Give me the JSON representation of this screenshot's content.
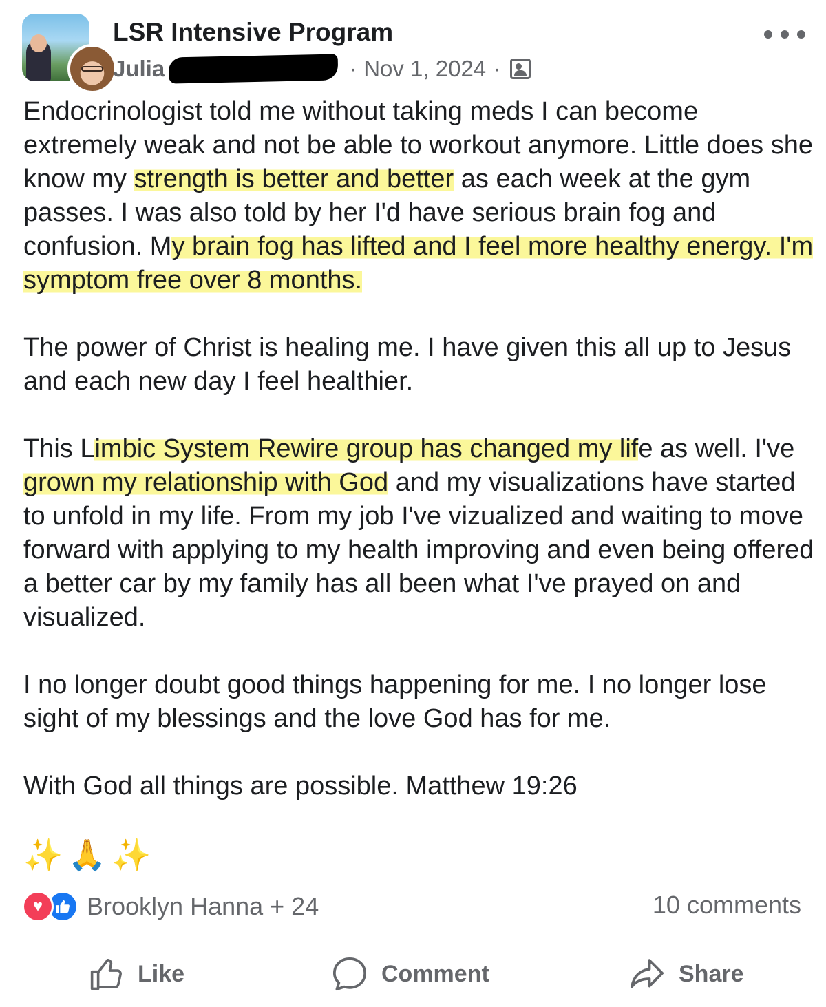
{
  "header": {
    "group_name": "LSR Intensive Program",
    "author_name": "Julia",
    "separator": "·",
    "date": "Nov 1, 2024",
    "privacy_icon": "members-group-icon",
    "more_icon": "more-options-icon"
  },
  "body": {
    "paragraphs": [
      [
        {
          "t": "Endocrinologist told me without taking meds I can become extremely weak and not be able to workout anymore. Little does she know my ",
          "hl": false
        },
        {
          "t": "strength is better and better",
          "hl": true
        },
        {
          "t": " as each week at the gym passes. I was also told by her I'd have serious brain fog and confusion. M",
          "hl": false
        },
        {
          "t": "y brain fog has lifted and I feel more healthy energy. I'm symptom free over 8 months.",
          "hl": true
        }
      ],
      [
        {
          "t": "The power of Christ is healing me. I have given this all up to Jesus and each new day I feel healthier.",
          "hl": false
        }
      ],
      [
        {
          "t": "This L",
          "hl": false
        },
        {
          "t": "imbic System Rewire group  has changed my lif",
          "hl": true
        },
        {
          "t": "e as well. I've ",
          "hl": false
        },
        {
          "t": "grown my relationship with God",
          "hl": true
        },
        {
          "t": " and my visualizations have started to unfold in my life. From my job I've vizualized and waiting to move forward with applying to my health improving and even being offered a better car by my family has all been what I've prayed on and visualized.",
          "hl": false
        }
      ],
      [
        {
          "t": "I no longer doubt good things happening for me. I  no longer lose sight of my blessings and the love God has for me.",
          "hl": false
        }
      ],
      [
        {
          "t": "With God all things are possible. Matthew 19:26",
          "hl": false
        }
      ]
    ],
    "emoji": {
      "sparkle": "✨",
      "pray": "🙏"
    }
  },
  "highlight_color": "#fbf79a",
  "reactions": {
    "types": [
      "love",
      "like"
    ],
    "love_color": "#f33e58",
    "like_color": "#1877f2",
    "reactors_text": "Brooklyn Hanna + 24",
    "comments_text": "10 comments"
  },
  "actions": {
    "like": "Like",
    "comment": "Comment",
    "share": "Share"
  }
}
